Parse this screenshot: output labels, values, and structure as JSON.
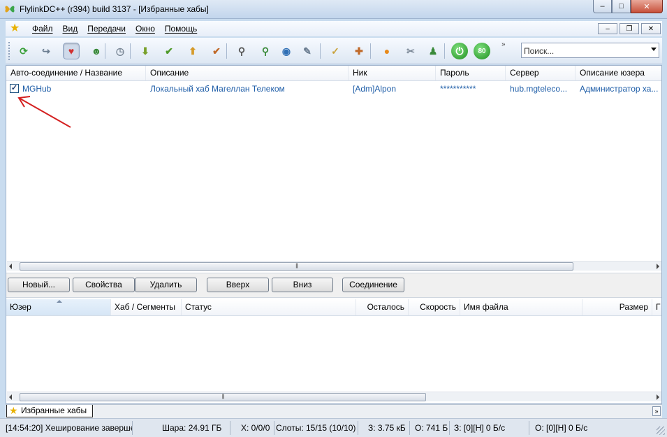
{
  "window": {
    "title": "FlylinkDC++ (r394) build 3137 - [Избранные хабы]",
    "minimize": "–",
    "maximize": "□",
    "close": "✕"
  },
  "menu": {
    "items": [
      "Файл",
      "Вид",
      "Передачи",
      "Окно",
      "Помощь"
    ],
    "mdi": [
      "–",
      "❐",
      "✕"
    ]
  },
  "toolbar": {
    "icons": [
      {
        "name": "reconnect-icon",
        "glyph": "⟳",
        "color": "#3aa03a"
      },
      {
        "name": "follow-redirect-icon",
        "glyph": "↪",
        "color": "#6a7c90"
      },
      {
        "name": "favorite-hubs-icon",
        "glyph": "♥",
        "color": "#d23030"
      },
      {
        "name": "favorite-users-icon",
        "glyph": "☻",
        "color": "#3a8a3a"
      },
      {
        "name": "recent-hubs-icon",
        "glyph": "◷",
        "color": "#7a8796"
      },
      {
        "name": "download-queue-icon",
        "glyph": "⬇",
        "color": "#78a02a"
      },
      {
        "name": "finished-downloads-icon",
        "glyph": "✔",
        "color": "#4f9a2a"
      },
      {
        "name": "upload-queue-icon",
        "glyph": "⬆",
        "color": "#d59a2a"
      },
      {
        "name": "finished-uploads-icon",
        "glyph": "✔",
        "color": "#c06a2a"
      },
      {
        "name": "search-icon",
        "glyph": "⚲",
        "color": "#555"
      },
      {
        "name": "adl-search-icon",
        "glyph": "⚲",
        "color": "#3a8a3a"
      },
      {
        "name": "search-spy-icon",
        "glyph": "◉",
        "color": "#2f6fb5"
      },
      {
        "name": "open-filelist-icon",
        "glyph": "✎",
        "color": "#6a7c90"
      },
      {
        "name": "notepad-icon",
        "glyph": "✓",
        "color": "#c9a23a"
      },
      {
        "name": "network-stats-icon",
        "glyph": "✚",
        "color": "#c06a2a"
      },
      {
        "name": "settings-icon",
        "glyph": "●",
        "color": "#e88a1a"
      },
      {
        "name": "clean-icon",
        "glyph": "✂",
        "color": "#7a8796"
      },
      {
        "name": "user-icon",
        "glyph": "♟",
        "color": "#3a8a3a"
      },
      {
        "name": "power-icon",
        "glyph": "⏻",
        "color": "#2fa42f"
      },
      {
        "name": "speed-limit-icon",
        "glyph": "80",
        "color": "#2fa42f"
      }
    ],
    "more": "»",
    "search_placeholder": "Поиск..."
  },
  "hubs": {
    "columns": [
      "Авто-соединение / Название",
      "Описание",
      "Ник",
      "Пароль",
      "Сервер",
      "Описание юзера"
    ],
    "rows": [
      {
        "checked": "✓",
        "name": "MGHub",
        "description": "Локальный хаб Магеллан Телеком",
        "nick": "[Adm]Alpon",
        "password": "***********",
        "server": "hub.mgteleco...",
        "user_description": "Администратор ха..."
      }
    ],
    "scroll_thumb": "|||"
  },
  "buttons": {
    "new": "Новый...",
    "properties": "Свойства",
    "remove": "Удалить",
    "up": "Вверх",
    "down": "Вниз",
    "connect": "Соединение"
  },
  "queue": {
    "columns": [
      "Юзер",
      "Хаб / Сегменты",
      "Статус",
      "Осталось",
      "Скорость",
      "Имя файла",
      "Размер",
      "Г"
    ],
    "scroll_thumb": "|||"
  },
  "tabs": {
    "active": "Избранные хабы",
    "more": "»"
  },
  "status": {
    "message": "[14:54:20] Хеширование заверше",
    "share": "Шара: 24.91 ГБ",
    "hubs": "Х: 0/0/0",
    "slots": "Слоты: 15/15 (10/10)",
    "downloaded": "З: 3.75 кБ",
    "uploaded": "О: 741 Б",
    "download_speed": "З: [0][Н] 0 Б/с",
    "upload_speed": "О: [0][Н] 0 Б/с"
  },
  "colors": {
    "link": "#1f5ea8",
    "arrow": "#d42020",
    "favorite_star": "#e8b100"
  }
}
